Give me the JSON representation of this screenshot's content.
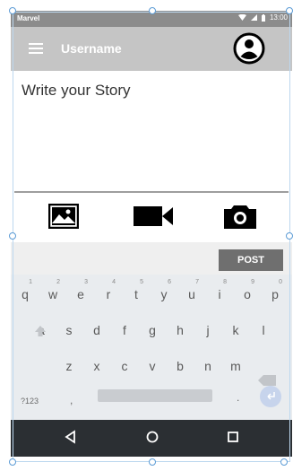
{
  "status_bar": {
    "carrier": "Marvel",
    "time": "13:00"
  },
  "app_bar": {
    "title": "Username",
    "menu_icon": "hamburger-menu-icon",
    "profile_icon": "user-avatar-icon"
  },
  "story": {
    "placeholder": "Write your Story"
  },
  "media_buttons": [
    "image-icon",
    "video-camera-icon",
    "camera-icon"
  ],
  "post_button": {
    "label": "POST"
  },
  "keyboard": {
    "row1": [
      {
        "key": "q",
        "hint": "1"
      },
      {
        "key": "w",
        "hint": "2"
      },
      {
        "key": "e",
        "hint": "3"
      },
      {
        "key": "r",
        "hint": "4"
      },
      {
        "key": "t",
        "hint": "5"
      },
      {
        "key": "y",
        "hint": "6"
      },
      {
        "key": "u",
        "hint": "7"
      },
      {
        "key": "i",
        "hint": "8"
      },
      {
        "key": "o",
        "hint": "9"
      },
      {
        "key": "p",
        "hint": "0"
      }
    ],
    "row2": [
      "a",
      "s",
      "d",
      "f",
      "g",
      "h",
      "j",
      "k",
      "l"
    ],
    "row3": [
      "z",
      "x",
      "c",
      "v",
      "b",
      "n",
      "m"
    ],
    "symbols_label": "?123",
    "comma": ",",
    "period": "."
  },
  "nav_bar": {
    "buttons": [
      "back-icon",
      "home-icon",
      "recents-icon"
    ]
  },
  "colors": {
    "status_bar": "#8c8c8c",
    "app_bar": "#c5c5c5",
    "post_button": "#6f6f6f",
    "keyboard": "#e9ecef",
    "nav_bar": "#2b2f33"
  }
}
